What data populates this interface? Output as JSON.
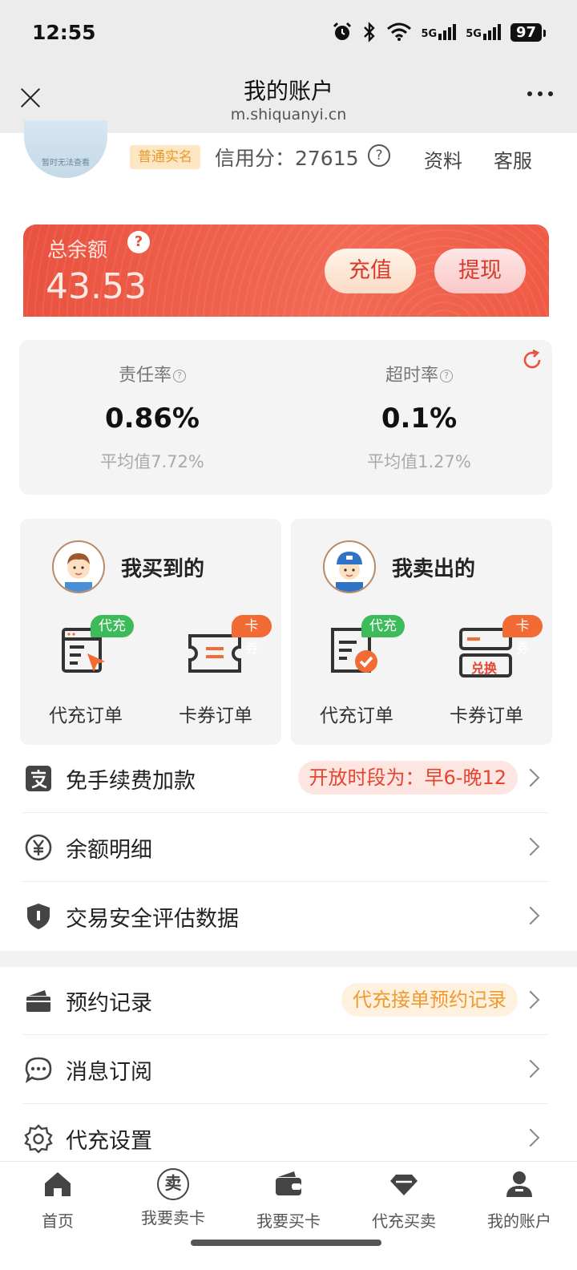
{
  "status_bar": {
    "time": "12:55",
    "net1": "5G",
    "net2": "5G",
    "battery": "97"
  },
  "title_bar": {
    "title": "我的账户",
    "url": "m.shiquanyi.cn"
  },
  "profile": {
    "avatar_text": "暂时无法查看",
    "badge": "普通实名",
    "credit_text": "信用分：27615",
    "credit_help": "?",
    "link_profile": "资料",
    "link_service": "客服"
  },
  "balance": {
    "label": "总余额",
    "help": "?",
    "amount": "43.53",
    "recharge_label": "充值",
    "withdraw_label": "提现"
  },
  "rates": {
    "left": {
      "label": "责任率",
      "value": "0.86%",
      "avg": "平均值7.72%"
    },
    "right": {
      "label": "超时率",
      "value": "0.1%",
      "avg": "平均值1.27%"
    }
  },
  "orders": {
    "buy": {
      "title": "我买到的",
      "items": [
        {
          "tag": "代充",
          "label": "代充订单"
        },
        {
          "tag": "卡券",
          "label": "卡券订单"
        }
      ]
    },
    "sell": {
      "title": "我卖出的",
      "items": [
        {
          "tag": "代充",
          "label": "代充订单"
        },
        {
          "tag": "卡券",
          "label": "卡券订单",
          "icon_text": "兑换"
        }
      ]
    }
  },
  "menu": [
    {
      "label": "免手续费加款",
      "badge": "开放时段为：早6-晚12"
    },
    {
      "label": "余额明细"
    },
    {
      "label": "交易安全评估数据"
    },
    {
      "label": "预约记录",
      "badge": "代充接单预约记录"
    },
    {
      "label": "消息订阅"
    },
    {
      "label": "代充设置"
    }
  ],
  "bottom_nav": [
    {
      "label": "首页",
      "icon": "home-icon"
    },
    {
      "label": "我要卖卡",
      "icon": "sell-icon",
      "icon_text": "卖"
    },
    {
      "label": "我要买卡",
      "icon": "wallet-icon"
    },
    {
      "label": "代充买卖",
      "icon": "diamond-icon"
    },
    {
      "label": "我的账户",
      "icon": "user-icon"
    }
  ],
  "colors": {
    "accent_red": "#e9513f",
    "tag_green": "#3dbb5a",
    "tag_orange": "#f26a34"
  }
}
